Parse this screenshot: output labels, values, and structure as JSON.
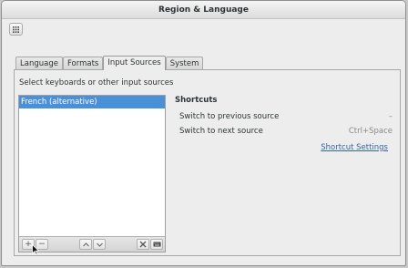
{
  "window": {
    "title": "Region & Language"
  },
  "toolbar": {
    "grid_icon": "view-grid-icon"
  },
  "tabs": [
    {
      "label": "Language"
    },
    {
      "label": "Formats"
    },
    {
      "label": "Input Sources"
    },
    {
      "label": "System"
    }
  ],
  "active_tab": "Input Sources",
  "input_sources": {
    "instruction": "Select keyboards or other input sources",
    "items": [
      {
        "label": "French (alternative)"
      }
    ],
    "buttons": {
      "add_icon": "plus-icon",
      "remove_icon": "minus-icon",
      "up_icon": "chevron-up-icon",
      "down_icon": "chevron-down-icon",
      "settings_icon": "tools-icon",
      "layout_icon": "keyboard-icon"
    }
  },
  "shortcuts": {
    "title": "Shortcuts",
    "rows": [
      {
        "label": "Switch to previous source",
        "value": "–"
      },
      {
        "label": "Switch to next source",
        "value": "Ctrl+Space"
      }
    ],
    "link_label": "Shortcut Settings"
  },
  "colors": {
    "selection": "#4a90d9",
    "link": "#3465a4"
  }
}
